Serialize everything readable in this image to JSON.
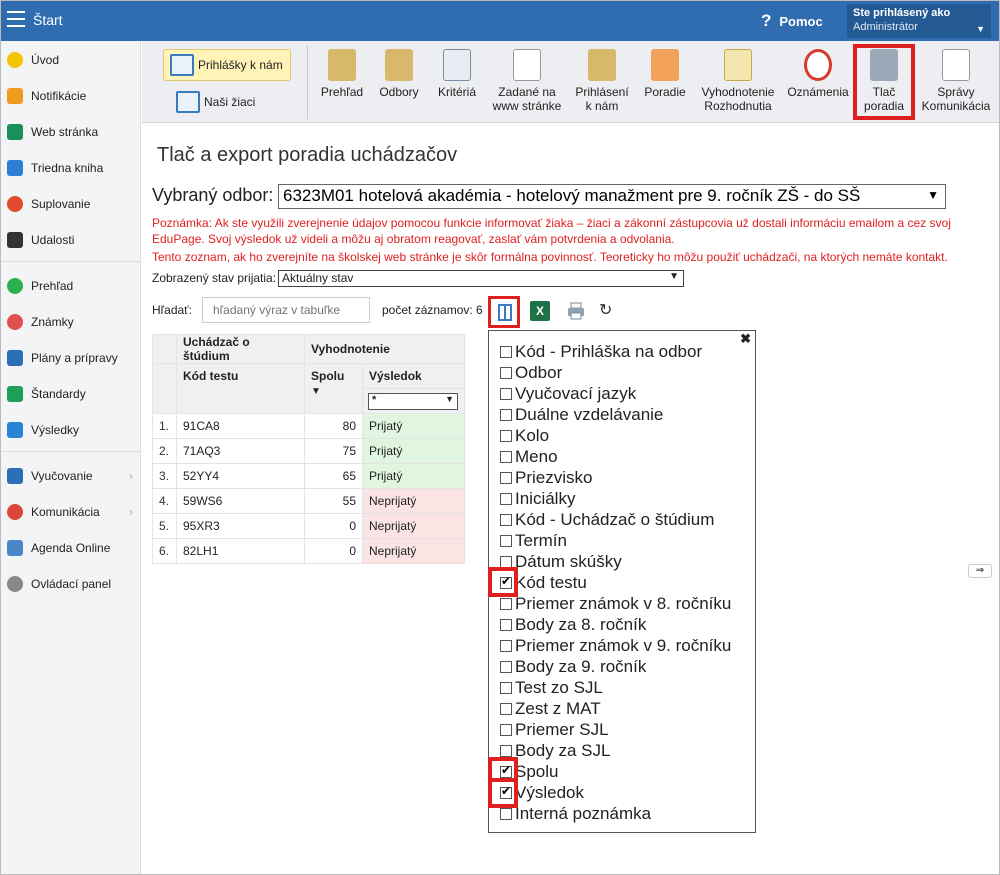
{
  "topbar": {
    "title": "Štart",
    "help": "Pomoc",
    "user_line1": "Ste prihlásený ako",
    "user_line2": "Administrátor"
  },
  "sidebar": {
    "items": [
      {
        "label": "Úvod"
      },
      {
        "label": "Notifikácie"
      },
      {
        "label": "Web stránka"
      },
      {
        "label": "Triedna kniha"
      },
      {
        "label": "Suplovanie"
      },
      {
        "label": "Udalosti"
      },
      {
        "label": "Prehľad"
      },
      {
        "label": "Známky"
      },
      {
        "label": "Plány a prípravy"
      },
      {
        "label": "Štandardy"
      },
      {
        "label": "Výsledky"
      },
      {
        "label": "Vyučovanie"
      },
      {
        "label": "Komunikácia"
      },
      {
        "label": "Agenda Online"
      },
      {
        "label": "Ovládací panel"
      }
    ]
  },
  "toolbar": {
    "left1": "Prihlášky k nám",
    "left2": "Naši žiaci",
    "buttons": [
      {
        "l1": "Prehľad",
        "l2": ""
      },
      {
        "l1": "Odbory",
        "l2": ""
      },
      {
        "l1": "Kritériá",
        "l2": ""
      },
      {
        "l1": "Zadané na",
        "l2": "www stránke"
      },
      {
        "l1": "Prihlásení",
        "l2": "k nám"
      },
      {
        "l1": "Poradie",
        "l2": ""
      },
      {
        "l1": "Vyhodnotenie",
        "l2": "Rozhodnutia"
      },
      {
        "l1": "Oznámenia",
        "l2": ""
      },
      {
        "l1": "Tlač",
        "l2": "poradia"
      },
      {
        "l1": "Správy",
        "l2": "Komunikácia"
      }
    ]
  },
  "main": {
    "title": "Tlač a export poradia uchádzačov",
    "odbor_label": "Vybraný odbor:",
    "odbor_value": "6323M01 hotelová akadémia - hotelový manažment pre 9. ročník ZŠ - do SŠ",
    "note1": "Poznámka: Ak ste využili zverejnenie údajov pomocou funkcie informovať žiaka – žiaci a zákonní zástupcovia už dostali informáciu emailom a cez svoj EduPage. Svoj výsledok už videli a môžu aj obratom reagovať, zaslať vám potvrdenia a odvolania.",
    "note2": "Tento zoznam, ak ho zverejníte na školskej web stránke je skôr formálna povinnosť. Teoreticky ho môžu použiť uchádzači, na ktorých nemáte kontakt.",
    "stav_label": "Zobrazený stav prijatia:",
    "stav_value": "Aktuálny stav",
    "search_label": "Hľadať:",
    "search_placeholder": "hľadaný výraz v tabuľke",
    "count_text": "počet záznamov: 6",
    "xls_label": "X"
  },
  "table": {
    "group1": "Uchádzač o štúdium",
    "group2": "Vyhodnotenie",
    "col_kod": "Kód testu",
    "col_spolu": "Spolu",
    "col_vysledok": "Výsledok",
    "filter_value": "*",
    "rows": [
      {
        "n": "1.",
        "kod": "91CA8",
        "spolu": "80",
        "vysledok": "Prijatý"
      },
      {
        "n": "2.",
        "kod": "71AQ3",
        "spolu": "75",
        "vysledok": "Prijatý"
      },
      {
        "n": "3.",
        "kod": "52YY4",
        "spolu": "65",
        "vysledok": "Prijatý"
      },
      {
        "n": "4.",
        "kod": "59WS6",
        "spolu": "55",
        "vysledok": "Neprijatý"
      },
      {
        "n": "5.",
        "kod": "95XR3",
        "spolu": "0",
        "vysledok": "Neprijatý"
      },
      {
        "n": "6.",
        "kod": "82LH1",
        "spolu": "0",
        "vysledok": "Neprijatý"
      }
    ]
  },
  "popup": {
    "options": [
      {
        "label": "Kód - Prihláška na odbor",
        "checked": false
      },
      {
        "label": "Odbor",
        "checked": false
      },
      {
        "label": "Vyučovací jazyk",
        "checked": false
      },
      {
        "label": "Duálne vzdelávanie",
        "checked": false
      },
      {
        "label": "Kolo",
        "checked": false
      },
      {
        "label": "Meno",
        "checked": false
      },
      {
        "label": "Priezvisko",
        "checked": false
      },
      {
        "label": "Iniciálky",
        "checked": false
      },
      {
        "label": "Kód - Uchádzač o štúdium",
        "checked": false
      },
      {
        "label": "Termín",
        "checked": false
      },
      {
        "label": "Dátum skúšky",
        "checked": false
      },
      {
        "label": "Kód testu",
        "checked": true
      },
      {
        "label": "Priemer známok v 8. ročníku",
        "checked": false
      },
      {
        "label": "Body za 8. ročník",
        "checked": false
      },
      {
        "label": "Priemer známok v 9. ročníku",
        "checked": false
      },
      {
        "label": "Body za 9. ročník",
        "checked": false
      },
      {
        "label": "Test zo SJL",
        "checked": false
      },
      {
        "label": "Zest z MAT",
        "checked": false
      },
      {
        "label": "Priemer SJL",
        "checked": false
      },
      {
        "label": "Body za SJL",
        "checked": false
      },
      {
        "label": "Spolu",
        "checked": true
      },
      {
        "label": "Výsledok",
        "checked": true
      },
      {
        "label": "Interná poznámka",
        "checked": false
      }
    ]
  }
}
